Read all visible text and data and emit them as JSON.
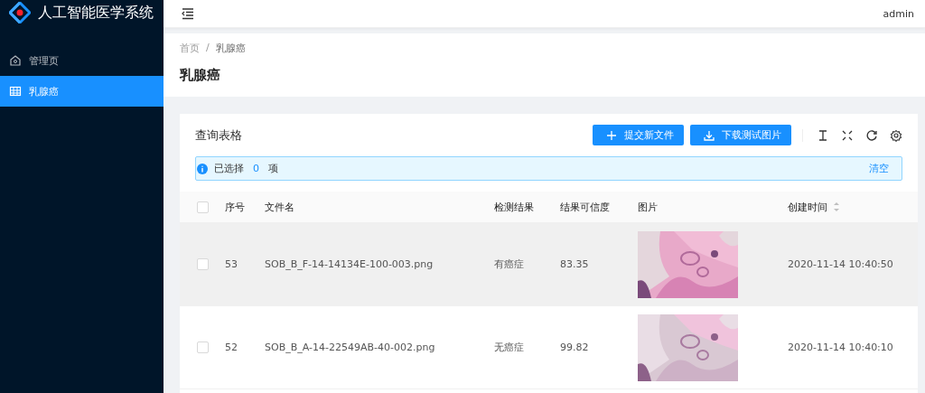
{
  "app": {
    "title": "人工智能医学系统"
  },
  "sidebar": {
    "items": [
      {
        "label": "管理页",
        "selected": false
      },
      {
        "label": "乳腺癌",
        "selected": true
      }
    ]
  },
  "header": {
    "user": "admin"
  },
  "breadcrumb": [
    "首页",
    "/",
    "乳腺癌"
  ],
  "page_title": "乳腺癌",
  "card": {
    "title": "查询表格",
    "buttons": [
      {
        "label": "提交新文件"
      },
      {
        "label": "下载测试图片"
      }
    ],
    "alert": {
      "prefix": "已选择",
      "count": "0",
      "suffix": "项",
      "action": "清空"
    },
    "table": {
      "all_checked": false,
      "columns": [
        "序号",
        "文件名",
        "检测结果",
        "结果可信度",
        "图片",
        "创建时间"
      ],
      "rows": [
        {
          "id": "53",
          "file": "SOB_B_F-14-14134E-100-003.png",
          "result": "有癌症",
          "confidence": "83.35",
          "created": "2020-11-14 10:40:50",
          "checked": false,
          "highlighted": true
        },
        {
          "id": "52",
          "file": "SOB_B_A-14-22549AB-40-002.png",
          "result": "无癌症",
          "confidence": "99.82",
          "created": "2020-11-14 10:40:10",
          "checked": false,
          "highlighted": false
        }
      ]
    }
  }
}
